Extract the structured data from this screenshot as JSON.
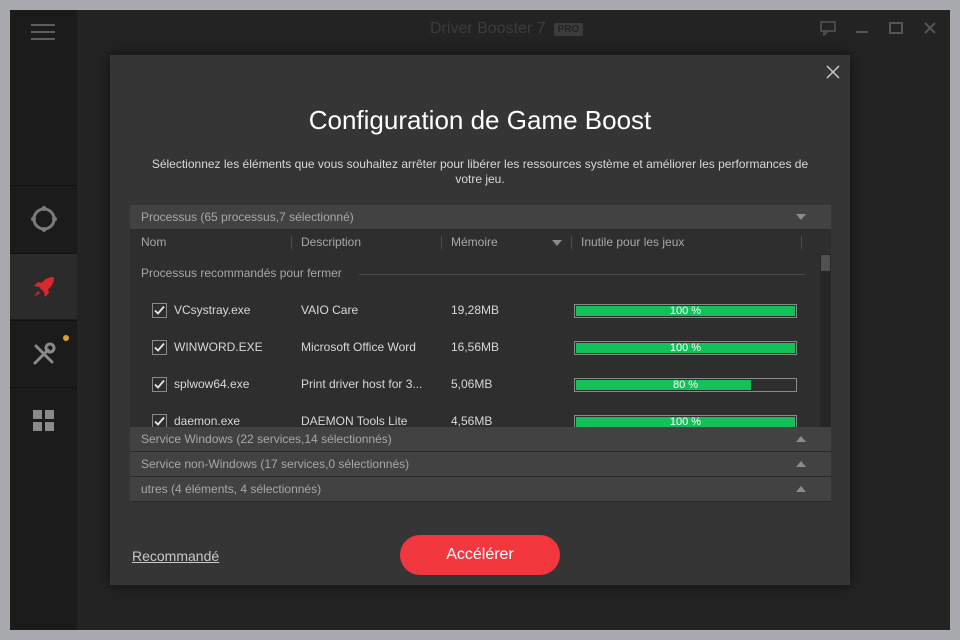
{
  "app": {
    "title": "Driver Booster 7",
    "badge": "PRO"
  },
  "sidebar": {
    "items": [
      {
        "name": "scan",
        "icon": "scan-ring-icon"
      },
      {
        "name": "boost",
        "icon": "rocket-icon",
        "active": true
      },
      {
        "name": "tools",
        "icon": "tools-icon",
        "notification": true
      },
      {
        "name": "action-center",
        "icon": "grid-icon"
      }
    ]
  },
  "dialog": {
    "title": "Configuration de Game Boost",
    "subtitle": "Sélectionnez les éléments que vous souhaitez arrêter pour libérer les ressources système et améliorer les performances de votre jeu.",
    "processes": {
      "header": "Processus (65 processus,7 sélectionné)",
      "columns": {
        "name": "Nom",
        "description": "Description",
        "memory": "Mémoire",
        "useless": "Inutile pour les jeux"
      },
      "group_label": "Processus recommandés pour fermer",
      "rows": [
        {
          "name": "VCsystray.exe",
          "description": "VAIO Care",
          "memory": "19,28MB",
          "useless_pct": 100,
          "useless_label": "100 %",
          "checked": true
        },
        {
          "name": "WINWORD.EXE",
          "description": "Microsoft Office Word",
          "memory": "16,56MB",
          "useless_pct": 100,
          "useless_label": "100 %",
          "checked": true
        },
        {
          "name": "splwow64.exe",
          "description": "Print driver host for 3...",
          "memory": "5,06MB",
          "useless_pct": 80,
          "useless_label": "80 %",
          "checked": true
        },
        {
          "name": "daemon.exe",
          "description": "DAEMON Tools Lite",
          "memory": "4,56MB",
          "useless_pct": 100,
          "useless_label": "100 %",
          "checked": true
        }
      ]
    },
    "sections": [
      {
        "label": "Service Windows (22 services,14 sélectionnés)"
      },
      {
        "label": "Service non-Windows (17 services,0 sélectionnés)"
      },
      {
        "label": "utres (4 éléments, 4 sélectionnés)"
      }
    ],
    "recommended_label": "Recommandé",
    "boost_label": "Accélérer"
  },
  "colors": {
    "accent": "#f2373f",
    "bar_fill": "#13c05a",
    "dialog_bg": "#353535"
  }
}
